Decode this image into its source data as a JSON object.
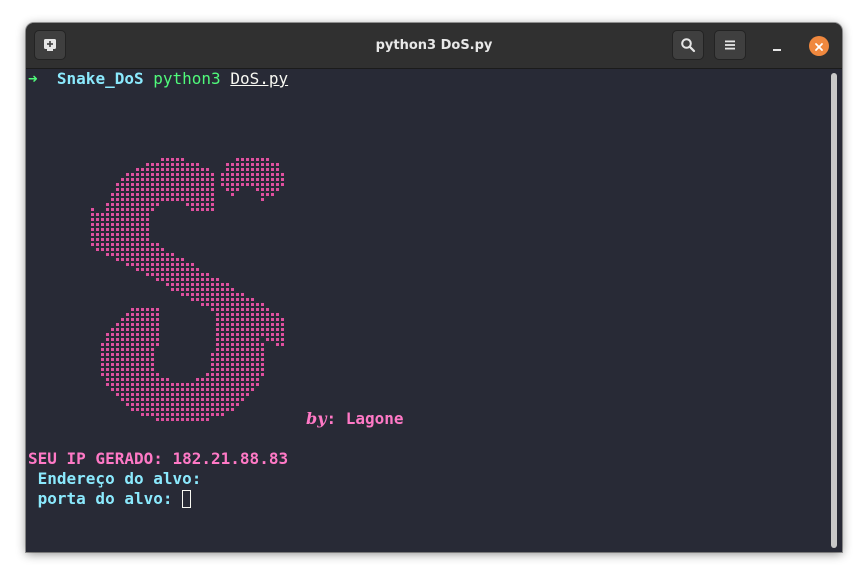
{
  "window": {
    "title": "python3 DoS.py"
  },
  "terminal": {
    "prompt_arrow": "➜",
    "directory": "Snake_DoS",
    "command": "python3",
    "argument": "DoS.py",
    "credit_by": "by",
    "credit_sep": ":",
    "credit_name": "Lagone",
    "ip_line": "SEU IP GERADO: 182.21.88.83",
    "target_address_prompt": " Endereço do alvo:",
    "target_port_prompt": " porta do alvo:"
  },
  "colors": {
    "background": "#282a36",
    "prompt_green": "#50fa7b",
    "cyan": "#8be9fd",
    "pink": "#ff79c6",
    "ascii_art_pink": "#e0509f",
    "close_button": "#f0883e"
  },
  "icons": {
    "new_tab": "new-tab-icon",
    "search": "search-icon",
    "menu": "hamburger-menu-icon",
    "minimize": "minimize-icon",
    "close": "close-icon"
  }
}
